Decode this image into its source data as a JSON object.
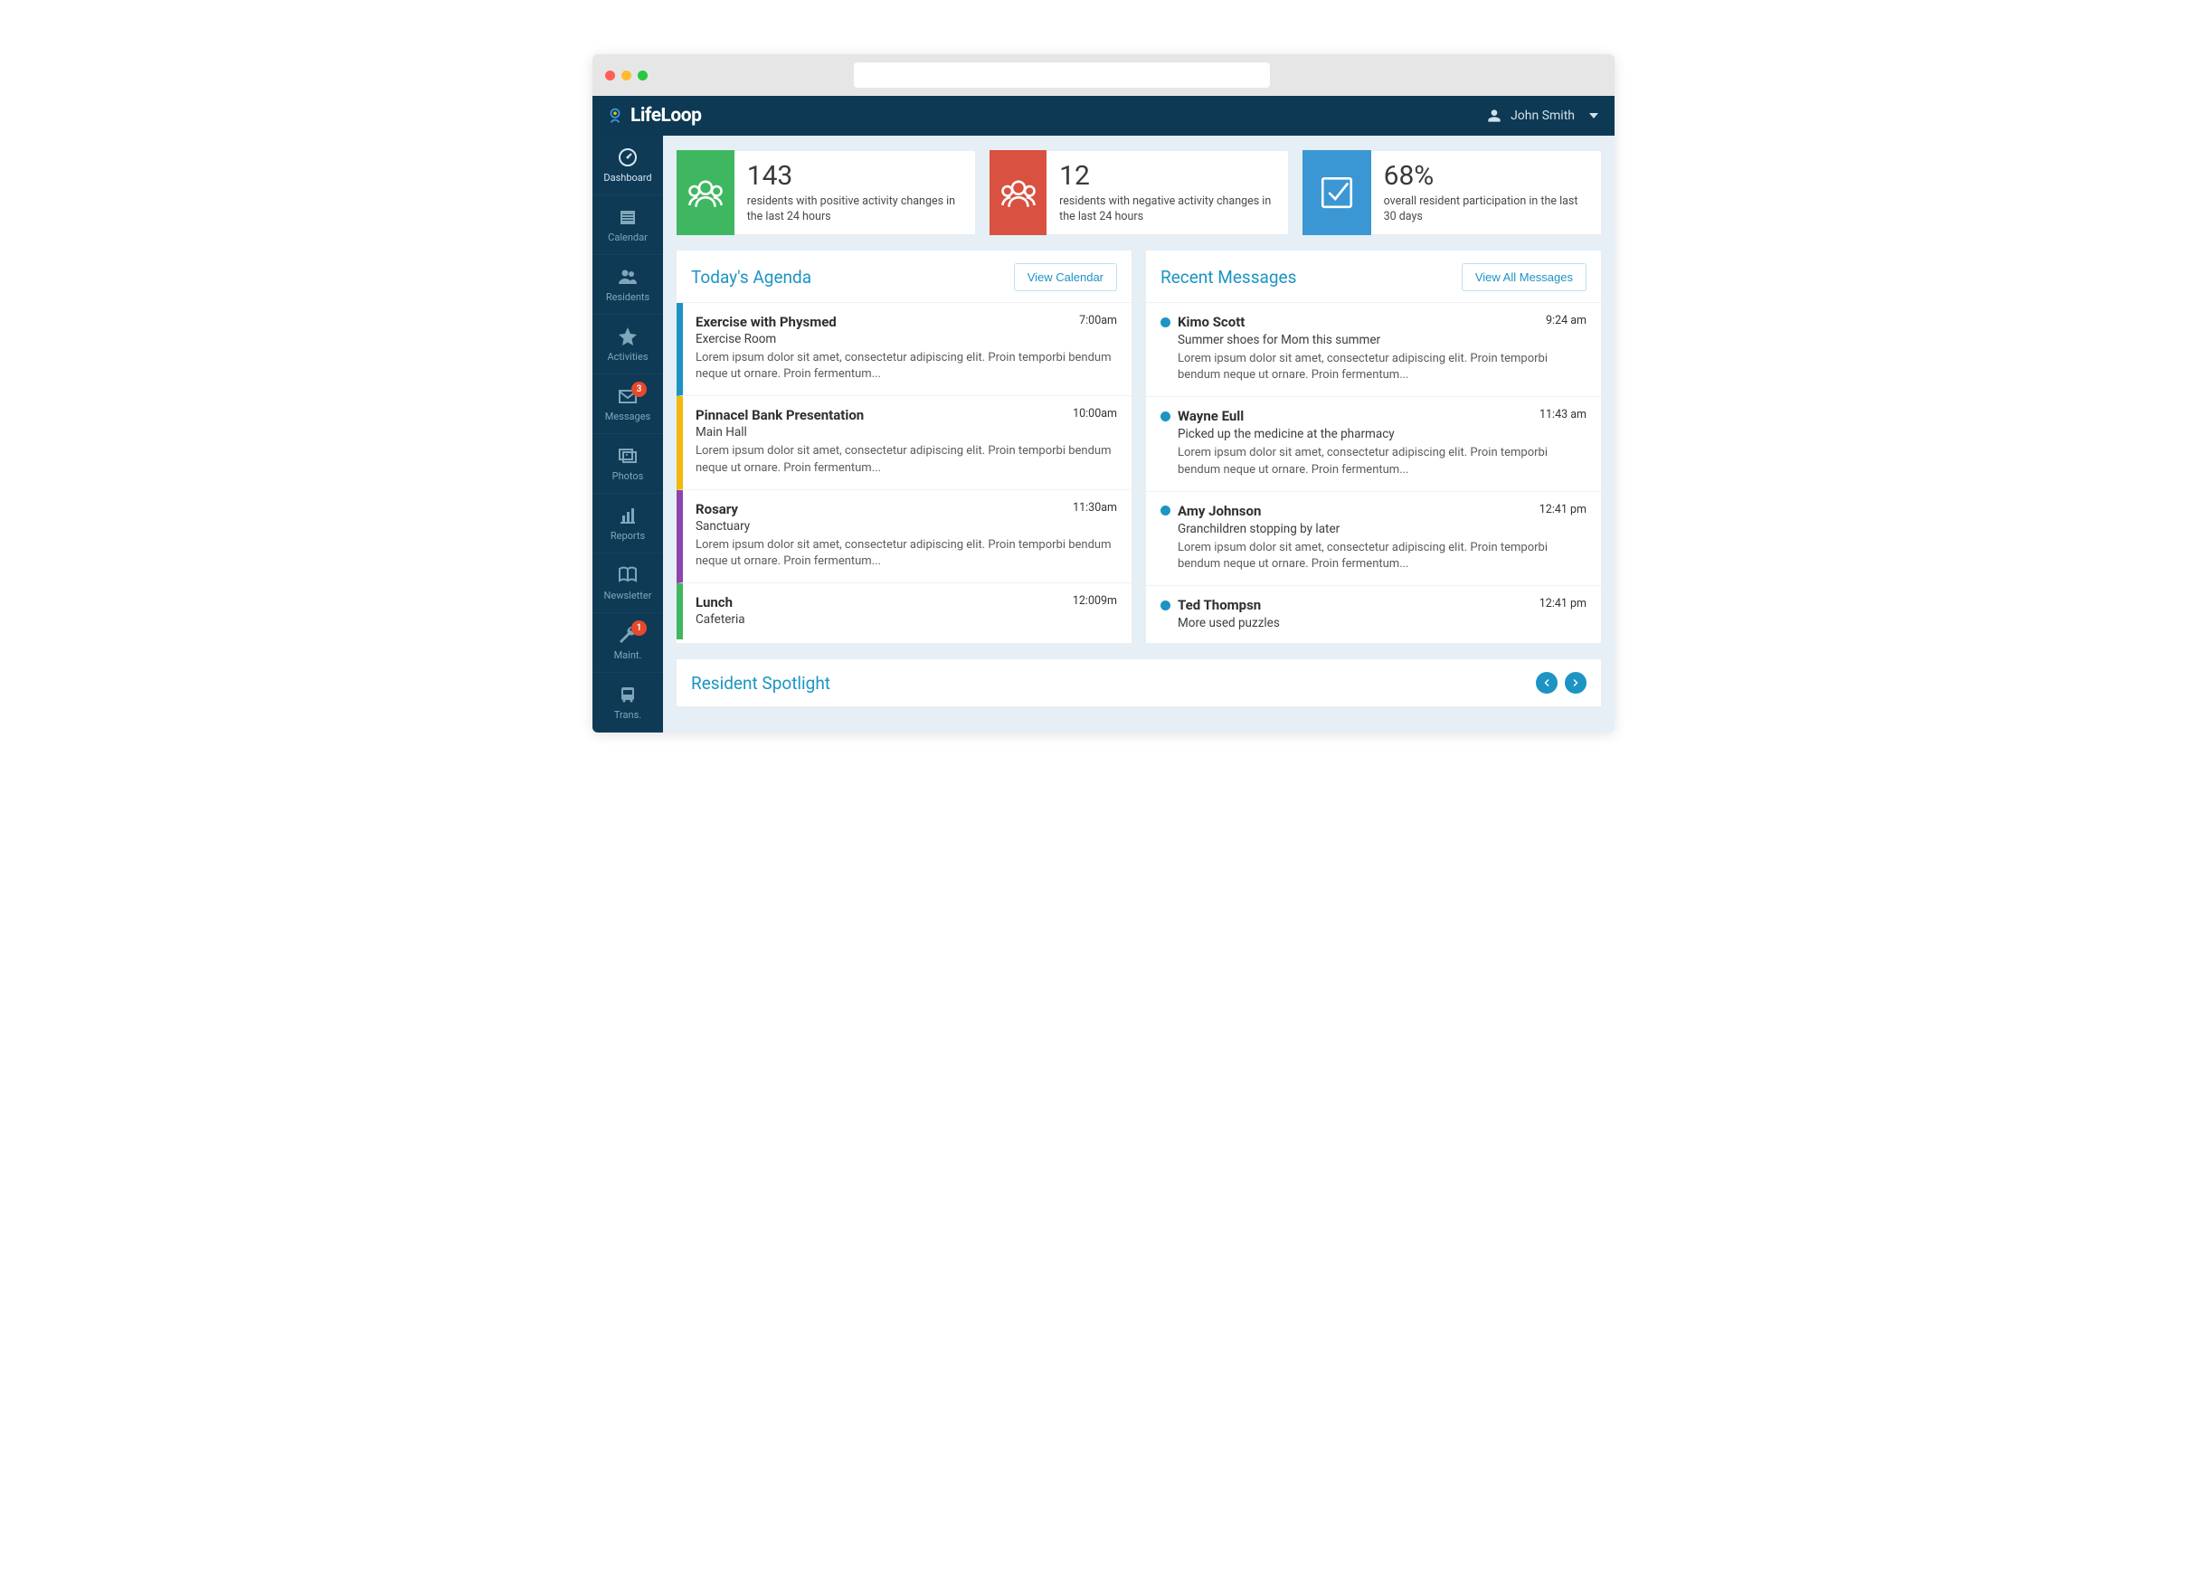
{
  "header": {
    "brand": "LifeLoop",
    "user_name": "John Smith"
  },
  "sidebar": {
    "items": [
      {
        "label": "Dashboard",
        "icon": "gauge",
        "badge": null,
        "active": true
      },
      {
        "label": "Calendar",
        "icon": "calendar",
        "badge": null
      },
      {
        "label": "Residents",
        "icon": "people",
        "badge": null
      },
      {
        "label": "Activities",
        "icon": "star",
        "badge": null
      },
      {
        "label": "Messages",
        "icon": "envelope",
        "badge": "3"
      },
      {
        "label": "Photos",
        "icon": "photos",
        "badge": null
      },
      {
        "label": "Reports",
        "icon": "chart",
        "badge": null
      },
      {
        "label": "Newsletter",
        "icon": "book",
        "badge": null
      },
      {
        "label": "Maint.",
        "icon": "wrench",
        "badge": "1"
      },
      {
        "label": "Trans.",
        "icon": "bus",
        "badge": null
      }
    ]
  },
  "stats": [
    {
      "value": "143",
      "desc": "residents with positive activity changes in the last 24 hours",
      "color": "green",
      "icon": "group"
    },
    {
      "value": "12",
      "desc": "residents with negative activity changes in the last 24 hours",
      "color": "red",
      "icon": "group"
    },
    {
      "value": "68%",
      "desc": "overall resident participation in the last 30 days",
      "color": "blue",
      "icon": "check"
    }
  ],
  "agenda": {
    "title": "Today's Agenda",
    "action": "View Calendar",
    "items": [
      {
        "title": "Exercise with Physmed",
        "location": "Exercise Room",
        "time": "7:00am",
        "color": "#1c94c4",
        "desc": "Lorem ipsum dolor sit amet, consectetur adipiscing elit. Proin temporbi bendum neque ut ornare. Proin fermentum..."
      },
      {
        "title": "Pinnacel Bank Presentation",
        "location": "Main Hall",
        "time": "10:00am",
        "color": "#f2b90c",
        "desc": "Lorem ipsum dolor sit amet, consectetur adipiscing elit. Proin temporbi bendum neque ut ornare. Proin fermentum..."
      },
      {
        "title": "Rosary",
        "location": "Sanctuary",
        "time": "11:30am",
        "color": "#8e44ad",
        "desc": "Lorem ipsum dolor sit amet, consectetur adipiscing elit. Proin temporbi bendum neque ut ornare. Proin fermentum..."
      },
      {
        "title": "Lunch",
        "location": "Cafeteria",
        "time": "12:009m",
        "color": "#3fb760",
        "desc": ""
      }
    ]
  },
  "messages": {
    "title": "Recent Messages",
    "action": "View All Messages",
    "items": [
      {
        "sender": "Kimo Scott",
        "time": "9:24 am",
        "subject": "Summer shoes for Mom this summer",
        "preview": "Lorem ipsum dolor sit amet, consectetur adipiscing elit. Proin temporbi bendum neque ut ornare. Proin fermentum..."
      },
      {
        "sender": "Wayne Eull",
        "time": "11:43 am",
        "subject": "Picked up the medicine at the pharmacy",
        "preview": "Lorem ipsum dolor sit amet, consectetur adipiscing elit. Proin temporbi bendum neque ut ornare. Proin fermentum..."
      },
      {
        "sender": "Amy Johnson",
        "time": "12:41 pm",
        "subject": "Granchildren stopping by later",
        "preview": "Lorem ipsum dolor sit amet, consectetur adipiscing elit. Proin temporbi bendum neque ut ornare. Proin fermentum..."
      },
      {
        "sender": "Ted Thompsn",
        "time": "12:41 pm",
        "subject": "More used puzzles",
        "preview": ""
      }
    ]
  },
  "spotlight": {
    "title": "Resident Spotlight"
  }
}
